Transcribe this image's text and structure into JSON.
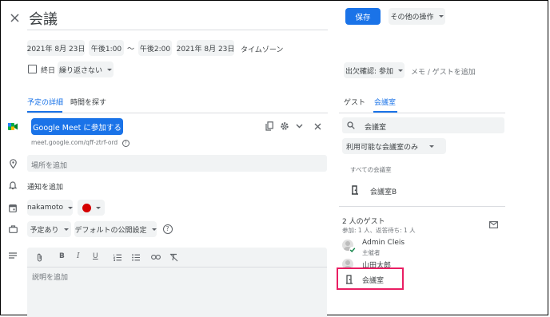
{
  "header": {
    "title": "会議",
    "save_label": "保存",
    "more_actions_label": "その他の操作"
  },
  "datetime": {
    "start_date": "2021年 8月 23日",
    "start_time": "午後1:00",
    "separator": "〜",
    "end_time": "午後2:00",
    "end_date": "2021年 8月 23日",
    "timezone_label": "タイムゾーン",
    "allday_label": "終日",
    "repeat_label": "繰り返さない"
  },
  "tabs": {
    "details": "予定の詳細",
    "find_time": "時間を探す"
  },
  "meet": {
    "button_label": "Google Meet に参加する",
    "link": "meet.google.com/qff-ztrf-ord"
  },
  "location": {
    "placeholder": "場所を追加"
  },
  "notification": {
    "label": "通知を追加"
  },
  "calendar": {
    "owner": "nakamoto",
    "color": "#d50000"
  },
  "availability": {
    "status": "予定あり",
    "visibility": "デフォルトの公開設定"
  },
  "description": {
    "placeholder": "説明を追加"
  },
  "rsvp": {
    "label": "出欠確認: 参加",
    "memo_label": "メモ / ゲストを追加"
  },
  "right_tabs": {
    "guests": "ゲスト",
    "rooms": "会議室"
  },
  "rooms": {
    "search_value": "会議室",
    "filter_label": "利用可能な会議室のみ",
    "section_label": "すべての会議室",
    "room_b": "会議室B"
  },
  "guests": {
    "count_label": "2 人のゲスト",
    "summary": "参加: 1 人、返答待ち: 1 人",
    "list": [
      {
        "name": "Admin Cleis",
        "role": "主催者"
      },
      {
        "name": "山田太郎",
        "role": ""
      }
    ],
    "room_entry": "会議室"
  },
  "colors": {
    "accent": "#1a73e8",
    "highlight_box": "#e91e63",
    "calendar_dot": "#d50000"
  }
}
